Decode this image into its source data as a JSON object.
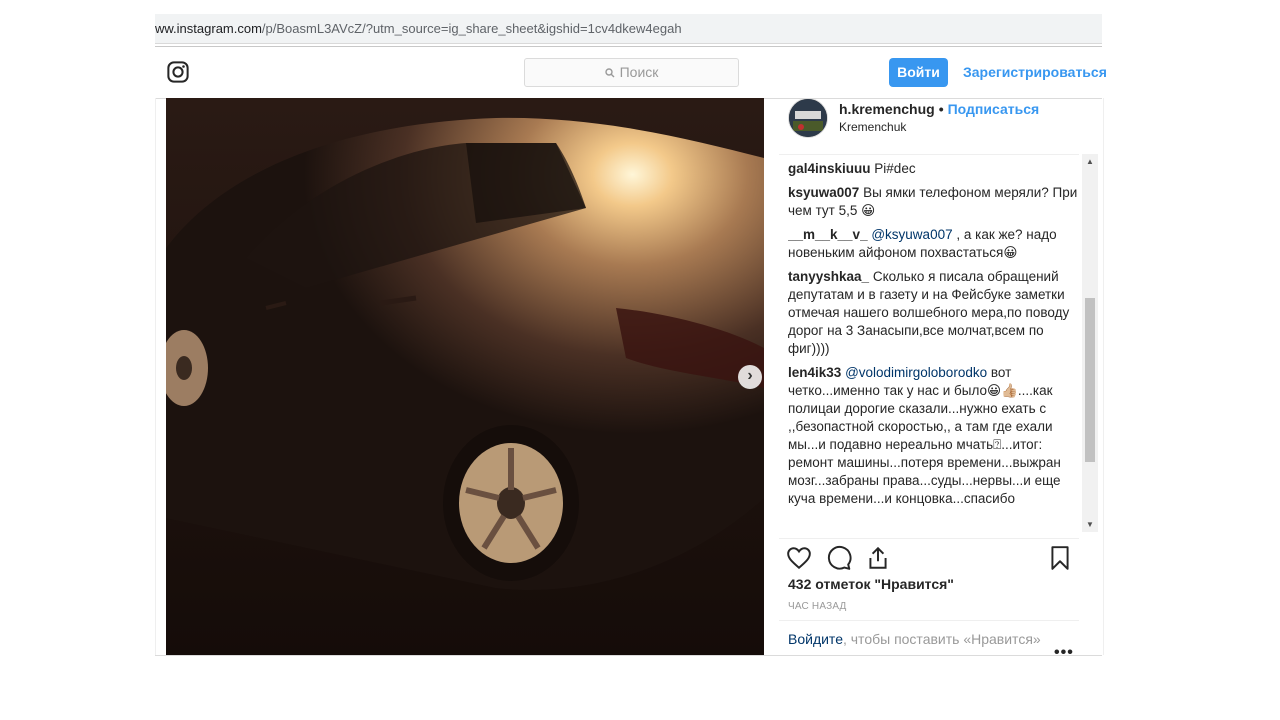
{
  "browser": {
    "url_host": "ww.instagram.com",
    "url_path": "/p/BoasmL3AVcZ/?utm_source=ig_share_sheet&igshid=1cv4dkew4egah"
  },
  "header": {
    "logo_icon": "instagram-icon",
    "search_placeholder": "Поиск",
    "login_label": "Войти",
    "register_label": "Зарегистрироваться"
  },
  "post": {
    "photo_icon": "car-photo",
    "author": "h.kremenchug",
    "dot": "•",
    "follow_label": "Подписаться",
    "location": "Kremenchuk",
    "comments": [
      {
        "user": "gal4inskiuuu",
        "mention": "",
        "text": "Pi#dec"
      },
      {
        "user": "ksyuwa007",
        "mention": "",
        "text": "Вы ямки телефоном меряли? При чем тут 5,5 😀"
      },
      {
        "user": "__m__k__v_",
        "mention": "@ksyuwa007",
        "text": ", а как же? надо новеньким айфоном похвастаться😀"
      },
      {
        "user": "tanyyshkaa_",
        "mention": "",
        "text": "Сколько я писала обращений депутатам и в газету и на Фейсбуке заметки отмечая нашего волшебного мера,по поводу дорог на 3 Занасыпи,все молчат,всем по фиг))))"
      },
      {
        "user": "len4ik33",
        "mention": "@volodimirgoloborodko",
        "text": "вот четко...именно так у нас и было😀👍🏼....как полицаи дорогие сказали...нужно ехать с ,,безопастной скоростью,, а там где ехали мы...и подавно нереально мчать⍰...итог: ремонт машины...потеря времени...выжран мозг...забраны права...суды...нервы...и еще куча времени...и концовка...спасибо"
      }
    ],
    "likes_text": "432 отметок \"Нравится\"",
    "time_text": "час назад",
    "login_link": "Войдите",
    "login_rest": ", чтобы поставить «Нравится»",
    "more_label": "•••",
    "next_label": "›"
  }
}
